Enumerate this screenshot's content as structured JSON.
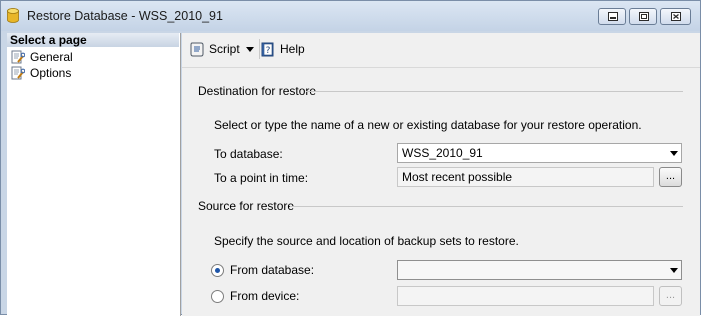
{
  "window": {
    "title": "Restore Database - WSS_2010_91",
    "caption_buttons": {
      "minimize": "▭",
      "maximize": "▣",
      "close": "✕"
    }
  },
  "left_pane": {
    "header": "Select a page",
    "pages": [
      {
        "label": "General",
        "icon": "page-wrench-icon"
      },
      {
        "label": "Options",
        "icon": "page-wrench-icon"
      }
    ]
  },
  "toolbar": {
    "script_label": "Script",
    "help_label": "Help"
  },
  "destination": {
    "section_label": "Destination for restore",
    "instruction": "Select or type the name of a new or existing database for your restore operation.",
    "to_database_label": "To database:",
    "to_database_value": "WSS_2010_91",
    "point_in_time_label": "To a point in time:",
    "point_in_time_value": "Most recent possible",
    "ellipsis": "..."
  },
  "source": {
    "section_label": "Source for restore",
    "instruction": "Specify the source and location of backup sets to restore.",
    "from_database_label": "From database:",
    "from_database_value": "",
    "from_device_label": "From device:",
    "from_device_value": "",
    "ellipsis": "...",
    "selected": "From database"
  },
  "colors": {
    "title_bar": "#c4d3e6",
    "pane_bg": "#f0f0f0",
    "radio_dot": "#1e55a8"
  }
}
